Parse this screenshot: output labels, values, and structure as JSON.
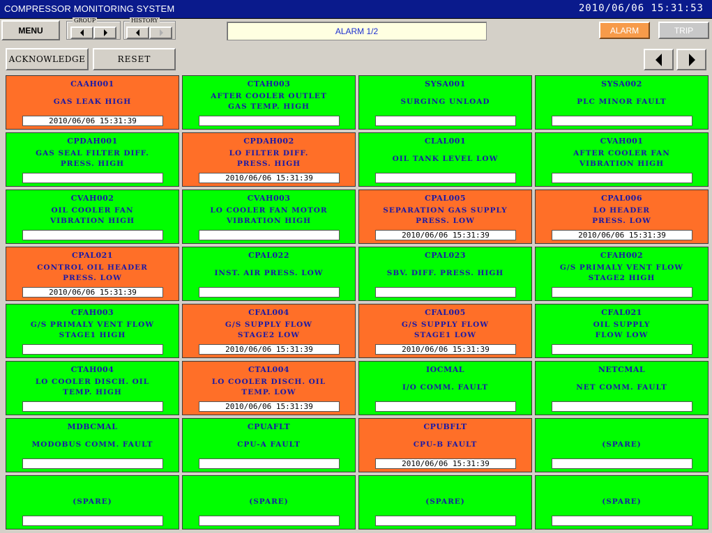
{
  "app": {
    "title": "COMPRESSOR MONITORING SYSTEM",
    "datetime": "2010/06/06  15:31:53"
  },
  "toolbar": {
    "menu_label": "MENU",
    "group_label": "GROUP",
    "history_label": "HISTORY",
    "alarm_page_label": "ALARM 1/2",
    "alarm_label": "ALARM",
    "trip_label": "TRIP",
    "acknowledge_label": "ACKNOWLEDGE",
    "reset_label": "RESET"
  },
  "colors": {
    "normal": "#00ff00",
    "active": "#ff6f28",
    "tag_text": "#1a1aa6",
    "title_bar": "#0a1a8c"
  },
  "alarms": [
    {
      "tag": "CAAH001",
      "desc": "GAS LEAK HIGH",
      "time": "2010/06/06 15:31:39",
      "state": "active"
    },
    {
      "tag": "CTAH003",
      "desc": "AFTER COOLER OUTLET\nGAS TEMP. HIGH",
      "time": "",
      "state": "normal"
    },
    {
      "tag": "SYSA001",
      "desc": "SURGING UNLOAD",
      "time": "",
      "state": "normal"
    },
    {
      "tag": "SYSA002",
      "desc": "PLC MINOR FAULT",
      "time": "",
      "state": "normal"
    },
    {
      "tag": "CPDAH001",
      "desc": "GAS SEAL FILTER DIFF.\nPRESS. HIGH",
      "time": "",
      "state": "normal"
    },
    {
      "tag": "CPDAH002",
      "desc": "LO FILTER DIFF.\nPRESS. HIGH",
      "time": "2010/06/06 15:31:39",
      "state": "active"
    },
    {
      "tag": "CLAL001",
      "desc": "OIL TANK LEVEL LOW",
      "time": "",
      "state": "normal"
    },
    {
      "tag": "CVAH001",
      "desc": "AFTER COOLER FAN\nVIBRATION HIGH",
      "time": "",
      "state": "normal"
    },
    {
      "tag": "CVAH002",
      "desc": "OIL COOLER FAN\nVIBRATION HIGH",
      "time": "",
      "state": "normal"
    },
    {
      "tag": "CVAH003",
      "desc": "LO COOLER FAN MOTOR\nVIBRATION HIGH",
      "time": "",
      "state": "normal"
    },
    {
      "tag": "CPAL005",
      "desc": "SEPARATION GAS SUPPLY\nPRESS. LOW",
      "time": "2010/06/06 15:31:39",
      "state": "active"
    },
    {
      "tag": "CPAL006",
      "desc": "LO HEADER\nPRESS. LOW",
      "time": "2010/06/06 15:31:39",
      "state": "active"
    },
    {
      "tag": "CPAL021",
      "desc": "CONTROL OIL HEADER\nPRESS. LOW",
      "time": "2010/06/06 15:31:39",
      "state": "active"
    },
    {
      "tag": "CPAL022",
      "desc": "INST. AIR PRESS. LOW",
      "time": "",
      "state": "normal"
    },
    {
      "tag": "CPAL023",
      "desc": "SBV. DIFF. PRESS. HIGH",
      "time": "",
      "state": "normal"
    },
    {
      "tag": "CFAH002",
      "desc": "G/S PRIMALY VENT FLOW\nSTAGE2 HIGH",
      "time": "",
      "state": "normal"
    },
    {
      "tag": "CFAH003",
      "desc": "G/S PRIMALY VENT FLOW\nSTAGE1 HIGH",
      "time": "",
      "state": "normal"
    },
    {
      "tag": "CFAL004",
      "desc": "G/S SUPPLY FLOW\nSTAGE2 LOW",
      "time": "2010/06/06 15:31:39",
      "state": "active"
    },
    {
      "tag": "CFAL005",
      "desc": "G/S SUPPLY FLOW\nSTAGE1 LOW",
      "time": "2010/06/06 15:31:39",
      "state": "active"
    },
    {
      "tag": "CFAL021",
      "desc": "OIL SUPPLY\nFLOW LOW",
      "time": "",
      "state": "normal"
    },
    {
      "tag": "CTAH004",
      "desc": "LO COOLER DISCH. OIL\nTEMP. HIGH",
      "time": "",
      "state": "normal"
    },
    {
      "tag": "CTAL004",
      "desc": "LO COOLER DISCH. OIL\nTEMP. LOW",
      "time": "2010/06/06 15:31:39",
      "state": "active"
    },
    {
      "tag": "IOCMAL",
      "desc": "I/O COMM. FAULT",
      "time": "",
      "state": "normal"
    },
    {
      "tag": "NETCMAL",
      "desc": "NET COMM. FAULT",
      "time": "",
      "state": "normal"
    },
    {
      "tag": "MDBCMAL",
      "desc": "MODOBUS COMM. FAULT",
      "time": "",
      "state": "normal"
    },
    {
      "tag": "CPUAFLT",
      "desc": "CPU-A FAULT",
      "time": "",
      "state": "normal"
    },
    {
      "tag": "CPUBFLT",
      "desc": "CPU-B FAULT",
      "time": "2010/06/06 15:31:39",
      "state": "active"
    },
    {
      "tag": "",
      "desc": "(SPARE)",
      "time": "",
      "state": "normal"
    },
    {
      "tag": "",
      "desc": "(SPARE)",
      "time": "",
      "state": "normal"
    },
    {
      "tag": "",
      "desc": "(SPARE)",
      "time": "",
      "state": "normal"
    },
    {
      "tag": "",
      "desc": "(SPARE)",
      "time": "",
      "state": "normal"
    },
    {
      "tag": "",
      "desc": "(SPARE)",
      "time": "",
      "state": "normal"
    }
  ]
}
